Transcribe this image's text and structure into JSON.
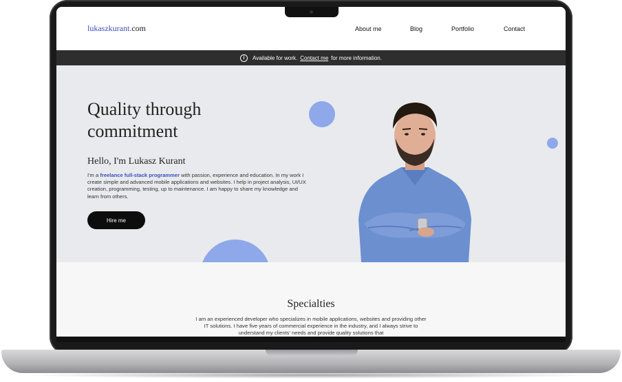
{
  "site": {
    "logo_prefix": "lukaszkurant",
    "logo_suffix": ".com"
  },
  "nav": {
    "items": [
      {
        "label": "About me"
      },
      {
        "label": "Blog"
      },
      {
        "label": "Portfolio"
      },
      {
        "label": "Contact"
      }
    ]
  },
  "banner": {
    "icon": "info-icon",
    "text_before": "Available for work.",
    "link": "Contact me",
    "text_after": "for more information."
  },
  "hero": {
    "title": "Quality through commitment",
    "greeting": "Hello, I'm Lukasz Kurant",
    "intro_prefix": "I'm a",
    "intro_highlight": "freelance full-stack programmer",
    "intro_rest": "with passion, experience and education. In my work I create simple and advanced mobile applications and websites. I help in project analysis, UI/UX creation, programming, testing, up to maintenance. I am happy to share my knowledge and learn from others.",
    "button_label": "Hire me"
  },
  "specialties": {
    "title": "Specialties",
    "text": "I am an experienced developer who specializes in mobile applications, websites and providing other IT solutions. I have five years of commercial experience in the industry, and I always strive to understand my clients' needs and provide quality solutions that"
  },
  "colors": {
    "accent": "#3b4fbf",
    "circles": "#8ea8ea",
    "banner_bg": "#2e2e2e",
    "hero_bg": "#e9eaed"
  }
}
